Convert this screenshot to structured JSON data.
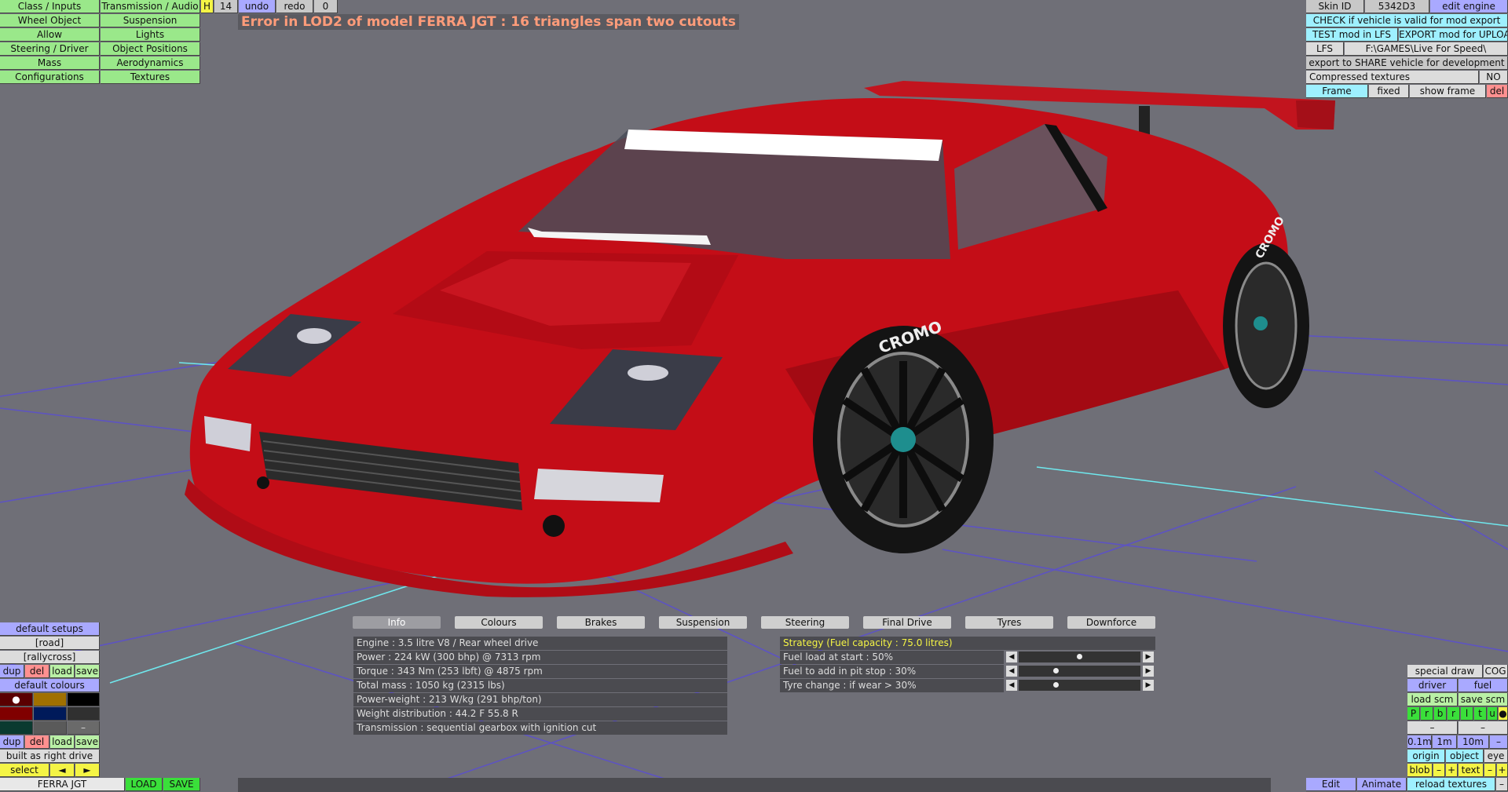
{
  "error_message": "Error in LOD2 of model FERRA JGT : 16 triangles span two cutouts",
  "top_left_menu": {
    "col1": [
      "Class / Inputs",
      "Wheel Object",
      "Allow",
      "Steering / Driver",
      "Mass",
      "Configurations"
    ],
    "col2": [
      "Transmission / Audio",
      "Suspension",
      "Lights",
      "Object Positions",
      "Aerodynamics",
      "Textures"
    ],
    "h_button": "H",
    "h_count": "14",
    "undo": "undo",
    "redo": "redo",
    "redo_count": "0"
  },
  "top_right_menu": {
    "skin_id_label": "Skin ID",
    "skin_id_value": "5342D3",
    "edit_engine": "edit engine",
    "check_valid": "CHECK if vehicle is valid for mod export",
    "test_mod": "TEST mod in LFS",
    "export_mod": "EXPORT mod for UPLOAD",
    "lfs_label": "LFS",
    "lfs_path": "F:\\GAMES\\Live For Speed\\",
    "export_share": "export to SHARE vehicle for development",
    "compressed_label": "Compressed textures",
    "compressed_value": "NO",
    "frame": "Frame",
    "fixed": "fixed",
    "show_frame": "show frame",
    "del": "del"
  },
  "tabs": [
    "Info",
    "Colours",
    "Brakes",
    "Suspension",
    "Steering",
    "Final Drive",
    "Tyres",
    "Downforce"
  ],
  "active_tab": "Info",
  "info_lines": [
    "Engine : 3.5 litre V8 / Rear wheel drive",
    "Power : 224 kW (300 bhp) @ 7313 rpm",
    "Torque : 343 Nm (253 lbft) @ 4875 rpm",
    "Total mass : 1050 kg (2315 lbs)",
    "Power-weight : 213 W/kg (291 bhp/ton)",
    "Weight distribution : 44.2 F  55.8 R",
    "Transmission : sequential gearbox with ignition cut"
  ],
  "strategy": {
    "title": "Strategy (Fuel capacity : 75.0 litres)",
    "rows": [
      {
        "label": "Fuel load at start : 50%",
        "value": 0.5
      },
      {
        "label": "Fuel to add in pit stop : 30%",
        "value": 0.3
      },
      {
        "label": "Tyre change : if wear > 30%",
        "value": 0.3
      }
    ]
  },
  "bottom_left": {
    "default_setups": "default setups",
    "setups": [
      "[road]",
      "[rallycross]"
    ],
    "dup": "dup",
    "del": "del",
    "load": "load",
    "save": "save",
    "default_colours": "default colours",
    "swatch_colors": [
      "#5a0000",
      "#a07000",
      "#000000",
      "#800000",
      "#001a5a",
      "#303030",
      "#0a3a30",
      "#5a5a5a",
      "#6a6a6a"
    ],
    "swatch_minus": "–",
    "built_as": "built as right drive",
    "select": "select",
    "prev": "◄",
    "next": "►",
    "model_name": "FERRA JGT",
    "load_btn": "LOAD",
    "save_btn": "SAVE"
  },
  "bottom_right": {
    "special_draw": "special draw",
    "cog": "COG",
    "driver": "driver",
    "fuel": "fuel",
    "load_scm": "load scm",
    "save_scm": "save scm",
    "pbr_letters": [
      "P",
      "r",
      "b",
      "r",
      "l",
      "t",
      "u"
    ],
    "dot": "●",
    "dash": "–",
    "scale": [
      "0.1m",
      "1m",
      "10m"
    ],
    "origin": "origin",
    "object": "object",
    "eye": "eye",
    "blob": "blob",
    "plus": "+",
    "text": "text",
    "edit": "Edit",
    "animate": "Animate",
    "reload_textures": "reload textures"
  }
}
